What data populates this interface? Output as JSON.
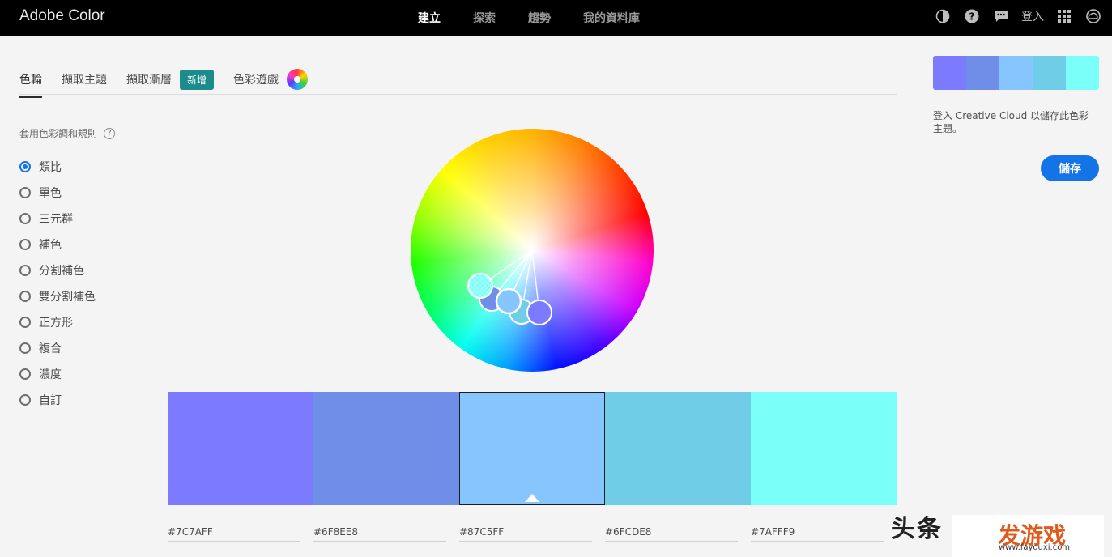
{
  "header": {
    "brand": "Adobe Color",
    "nav": [
      "建立",
      "探索",
      "趨勢",
      "我的資料庫"
    ],
    "signin": "登入",
    "icons": [
      "contrast-icon",
      "help-icon",
      "chat-icon",
      "apps-grid-icon",
      "creative-cloud-icon"
    ]
  },
  "tabs": {
    "items": [
      "色輪",
      "擷取主題",
      "擷取漸層",
      "色彩遊戲"
    ],
    "new_badge": "新增"
  },
  "rules": {
    "title": "套用色彩調和規則",
    "help": "?",
    "options": [
      "類比",
      "單色",
      "三元群",
      "補色",
      "分割補色",
      "雙分割補色",
      "正方形",
      "複合",
      "濃度",
      "自訂"
    ],
    "selected_index": 0
  },
  "palette": {
    "colors": [
      "#7C7AFF",
      "#6F8EE8",
      "#87C5FF",
      "#6FCDE8",
      "#7AFFF9"
    ],
    "hex_labels": [
      "#7C7AFF",
      "#6F8EE8",
      "#87C5FF",
      "#6FCDE8",
      "#7AFFF9"
    ],
    "selected_index": 2
  },
  "side": {
    "note": "登入 Creative Cloud 以儲存此色彩主題。",
    "save_label": "儲存"
  },
  "watermark": {
    "left": "头条",
    "brand": "发游戏",
    "url": "www.fayouxi.com"
  }
}
